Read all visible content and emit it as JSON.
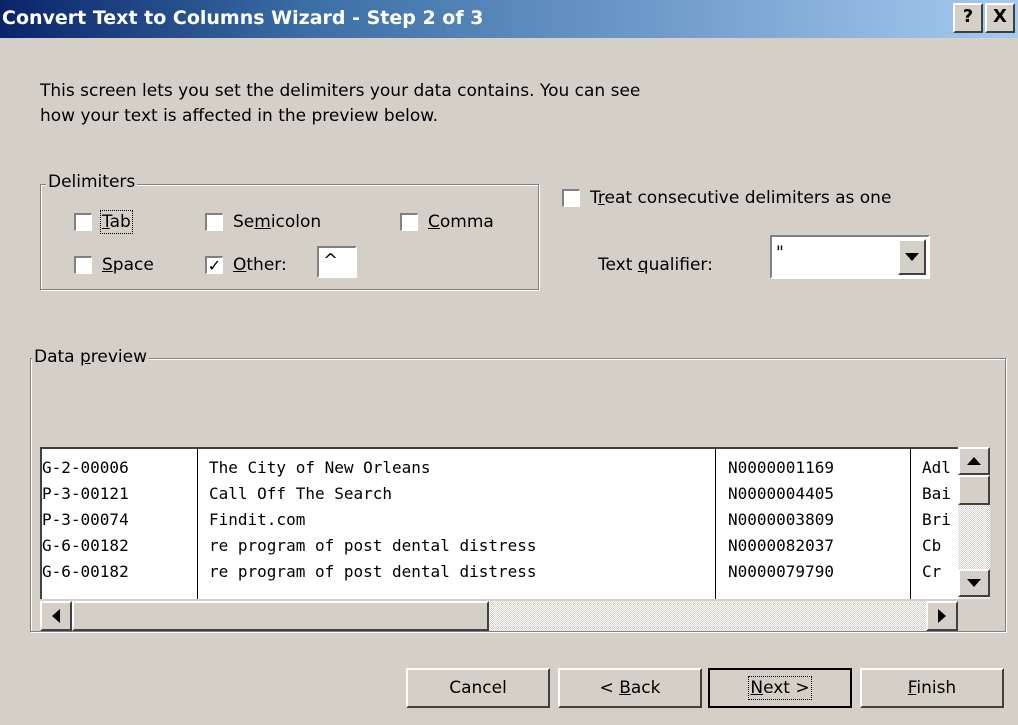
{
  "window": {
    "title": "Convert Text to Columns Wizard - Step 2 of 3",
    "help_label": "?",
    "close_label": "X"
  },
  "intro": {
    "line1": "This screen lets you set the delimiters your data contains.  You can see",
    "line2": "how your text is affected in the preview below."
  },
  "delimiters": {
    "legend": "Delimiters",
    "tab": {
      "pre": "",
      "key": "T",
      "post": "ab",
      "checked": false
    },
    "semicolon": {
      "pre": "Se",
      "key": "m",
      "post": "icolon",
      "checked": false
    },
    "comma": {
      "pre": "",
      "key": "C",
      "post": "omma",
      "checked": false
    },
    "space": {
      "pre": "",
      "key": "S",
      "post": "pace",
      "checked": false
    },
    "other": {
      "pre": "",
      "key": "O",
      "post": "ther:",
      "checked": true,
      "value": "^"
    }
  },
  "consecutive": {
    "pre": "T",
    "key": "r",
    "post": "eat consecutive delimiters as one",
    "checked": false
  },
  "qualifier": {
    "pre": "Text ",
    "key": "q",
    "post": "ualifier:",
    "value": "\""
  },
  "preview": {
    "legend_pre": "Data ",
    "legend_key": "p",
    "legend_post": "review",
    "rows": [
      [
        "G-2-00006",
        "The City of New Orleans",
        "N0000001169",
        "Adl"
      ],
      [
        "P-3-00121",
        "Call Off The Search",
        "N0000004405",
        "Bai"
      ],
      [
        "P-3-00074",
        "Findit.com",
        "N0000003809",
        "Bri"
      ],
      [
        "G-6-00182",
        "re program of post dental distress",
        "N0000082037",
        "Cb"
      ],
      [
        "G-6-00182",
        "re program of post dental distress",
        "N0000079790",
        "Cr"
      ]
    ]
  },
  "buttons": {
    "cancel": {
      "pre": "Cancel",
      "key": "",
      "post": ""
    },
    "back": {
      "pre": "< ",
      "key": "B",
      "post": "ack"
    },
    "next": {
      "pre": "",
      "key": "N",
      "post": "ext >"
    },
    "finish": {
      "pre": "",
      "key": "F",
      "post": "inish"
    }
  }
}
